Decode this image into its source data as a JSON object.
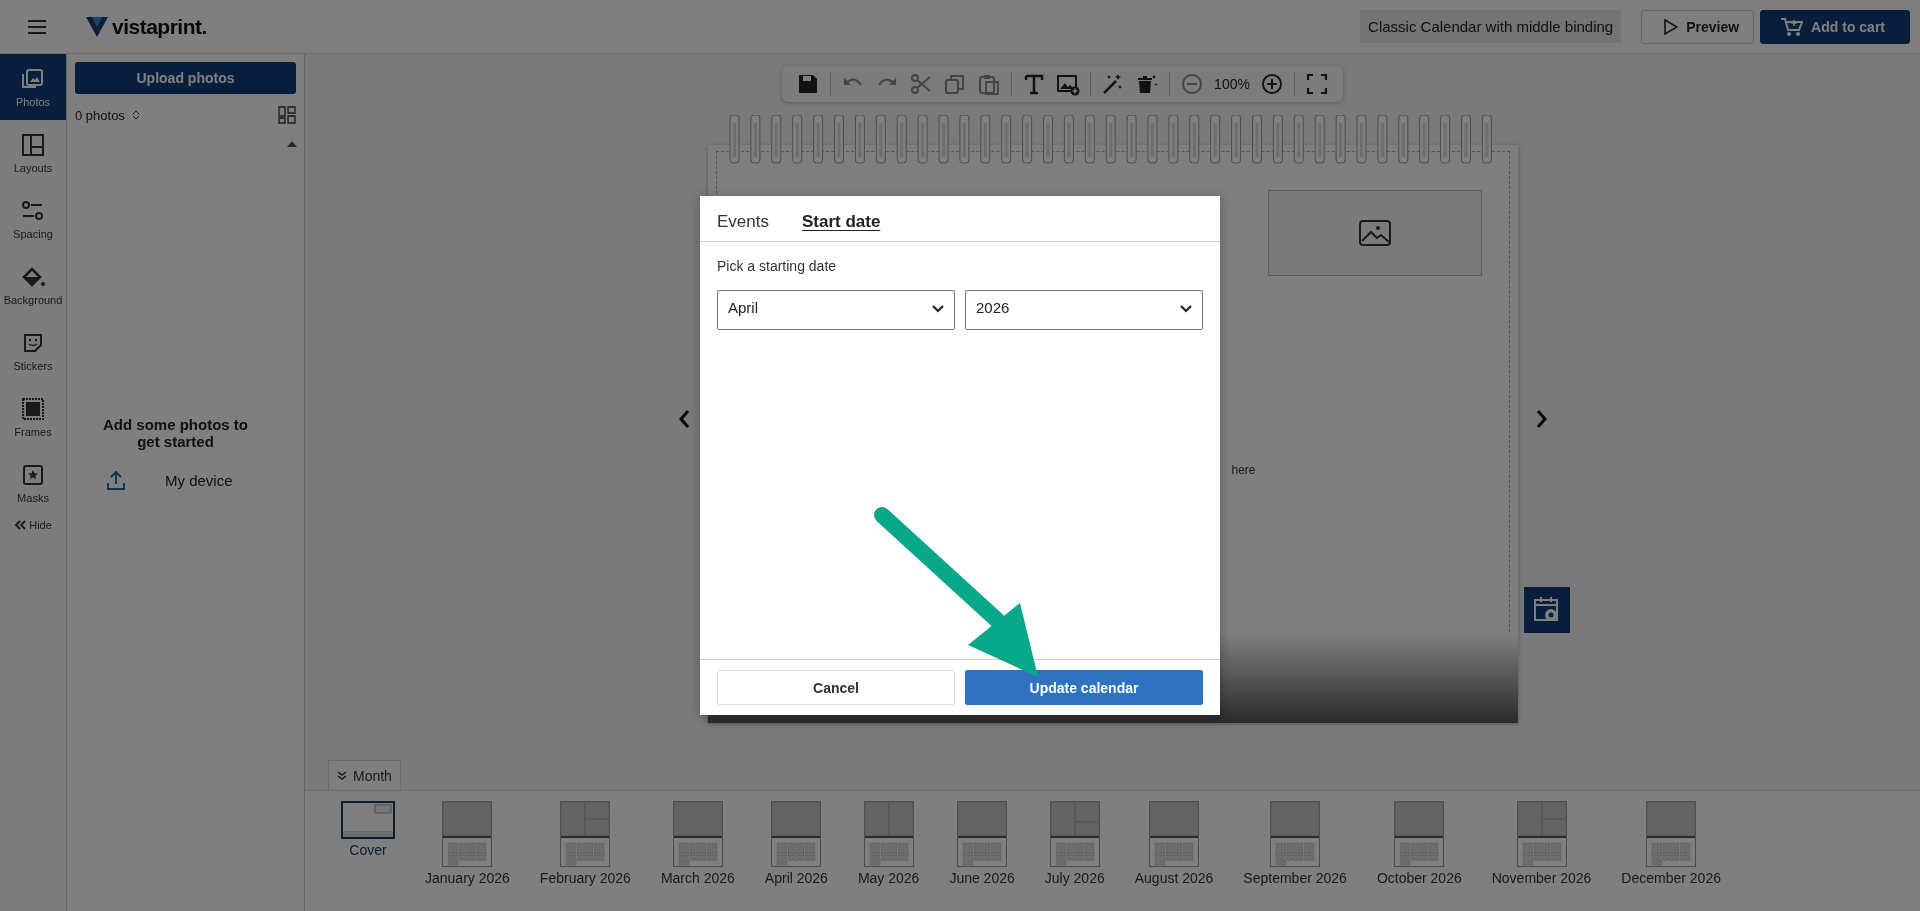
{
  "header": {
    "logo": "vistaprint.",
    "product_title": "Classic Calendar with middle binding",
    "buttons": [
      {
        "kind": "preview",
        "label": "Preview"
      },
      {
        "kind": "cart",
        "label": "Add to cart"
      }
    ]
  },
  "rail": {
    "items": [
      {
        "kind": "photos",
        "label": "Photos",
        "selected": true
      },
      {
        "kind": "layouts",
        "label": "Layouts",
        "selected": false
      },
      {
        "kind": "spacing",
        "label": "Spacing",
        "selected": false
      },
      {
        "kind": "background",
        "label": "Background",
        "selected": false
      },
      {
        "kind": "stickers",
        "label": "Stickers",
        "selected": false
      },
      {
        "kind": "frames",
        "label": "Frames",
        "selected": false
      },
      {
        "kind": "masks",
        "label": "Masks",
        "selected": false
      }
    ],
    "hide": "Hide"
  },
  "panel": {
    "upload": "Upload photos",
    "count": "0 photos",
    "empty_message": "Add some photos to get started",
    "source": "My device"
  },
  "toolbar": {
    "tools": [
      {
        "kind": "save",
        "disabled": false
      },
      {
        "kind": "sep"
      },
      {
        "kind": "undo",
        "disabled": true
      },
      {
        "kind": "redo",
        "disabled": true
      },
      {
        "kind": "cut",
        "disabled": true
      },
      {
        "kind": "copy",
        "disabled": true
      },
      {
        "kind": "paste",
        "disabled": true
      },
      {
        "kind": "sep"
      },
      {
        "kind": "text",
        "disabled": false
      },
      {
        "kind": "image",
        "disabled": false
      },
      {
        "kind": "sep"
      },
      {
        "kind": "magic",
        "disabled": false
      },
      {
        "kind": "clear",
        "disabled": false
      },
      {
        "kind": "sep"
      },
      {
        "kind": "zoom_out",
        "disabled": true
      },
      {
        "kind": "zoom_level",
        "label": "100%"
      },
      {
        "kind": "zoom_in",
        "disabled": false
      },
      {
        "kind": "sep"
      },
      {
        "kind": "fullscreen",
        "disabled": false
      }
    ]
  },
  "canvas": {
    "hint": "here"
  },
  "modal": {
    "tabs": [
      {
        "label": "Events",
        "selected": false
      },
      {
        "label": "Start date",
        "selected": true
      }
    ],
    "prompt": "Pick a starting date",
    "selects": [
      {
        "value": "April"
      },
      {
        "value": "2026"
      }
    ],
    "buttons": [
      {
        "kind": "secondary",
        "label": "Cancel"
      },
      {
        "kind": "primary",
        "label": "Update calendar"
      }
    ]
  },
  "pages": {
    "tab": "Month",
    "thumbnails": [
      {
        "label": "Cover",
        "kind": "cover",
        "selected": true
      },
      {
        "label": "January 2026",
        "kind": "single",
        "selected": false
      },
      {
        "label": "February 2026",
        "kind": "triple",
        "selected": false
      },
      {
        "label": "March 2026",
        "kind": "single",
        "selected": false
      },
      {
        "label": "April 2026",
        "kind": "single",
        "selected": false
      },
      {
        "label": "May 2026",
        "kind": "double",
        "selected": false
      },
      {
        "label": "June 2026",
        "kind": "single",
        "selected": false
      },
      {
        "label": "July 2026",
        "kind": "side",
        "selected": false
      },
      {
        "label": "August 2026",
        "kind": "single",
        "selected": false
      },
      {
        "label": "September 2026",
        "kind": "single",
        "selected": false
      },
      {
        "label": "October 2026",
        "kind": "single",
        "selected": false
      },
      {
        "label": "November 2026",
        "kind": "triple",
        "selected": false
      },
      {
        "label": "December 2026",
        "kind": "single",
        "selected": false
      }
    ]
  }
}
